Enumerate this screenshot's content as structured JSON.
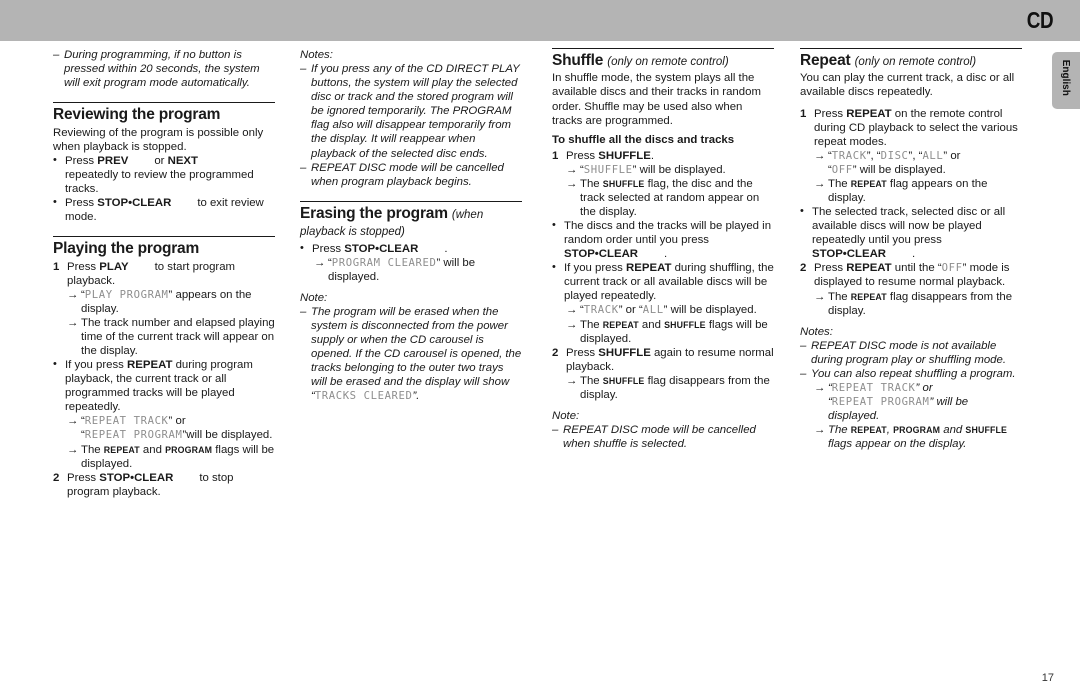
{
  "header": {
    "title": "CD",
    "language_tab": "English"
  },
  "page_number": "17",
  "col1": {
    "note_top": "During programming,  if no button is pressed within 20 seconds, the system will exit program mode automatically.",
    "s1": {
      "heading": "Reviewing the program",
      "intro": "Reviewing of the program is possible only when playback is stopped.",
      "b1_a": "Press ",
      "b1_prev": "PREV",
      "b1_or": "or ",
      "b1_next": "NEXT",
      "b1_b": "repeatedly to review the programmed tracks.",
      "b2_a": "Press ",
      "b2_btn": "STOP•CLEAR",
      "b2_b": "to exit review mode."
    },
    "s2": {
      "heading": "Playing the program",
      "n1_a": "Press ",
      "n1_btn": "PLAY",
      "n1_b": "to start program playback.",
      "a1_q1": "“",
      "a1_lcd": "PLAY PROGRAM",
      "a1_q2": "” appears on the display.",
      "a2": "The track number and elapsed playing time of the current track will appear on the display.",
      "b1_a": "If you press ",
      "b1_btn": "REPEAT",
      "b1_b": " during program playback, the current track or all programmed tracks will be played repeatedly.",
      "a3_lcd1": "REPEAT TRACK",
      "a3_mid": "” or",
      "a3_lcd2": "REPEAT PROGRAM",
      "a3_end": "”will be displayed.",
      "a4_pre": "The ",
      "a4_flag1": "REPEAT",
      "a4_mid": " and ",
      "a4_flag2": "PROGRAM",
      "a4_post": " flags will be displayed.",
      "n2_a": "Press ",
      "n2_btn": "STOP•CLEAR",
      "n2_b": "to stop program playback."
    }
  },
  "col2": {
    "notes_label": "Notes:",
    "note1": "If you press any of the CD DIRECT PLAY buttons, the system will play the selected disc or track and the stored program will be ignored temporarily. The PROGRAM flag also will disappear temporarily from the display. It will reappear when playback of the selected disc ends.",
    "note2": "REPEAT DISC mode will be cancelled when program playback begins.",
    "s1": {
      "heading": "Erasing the program",
      "heading_qual": "(when playback is stopped)",
      "b1_a": "Press ",
      "b1_btn": "STOP•CLEAR",
      "b1_dot": ".",
      "a1_lcd": "PROGRAM CLEARED",
      "a1_post": "” will be displayed.",
      "note_label": "Note:",
      "note_a": "The program will be erased when the system is disconnected from the power supply or when the CD carousel is opened.  If the CD carousel is opened, the tracks belonging to the outer two trays will be erased and the display will show “",
      "note_lcd": "TRACKS CLEARED",
      "note_b": "”."
    }
  },
  "col3": {
    "heading": "Shuffle",
    "heading_qual": "(only on remote control)",
    "intro": "In shuffle mode, the system plays all the available discs and their tracks in random order. Shuffle may be used also when tracks are programmed.",
    "subheading": "To shuffle all the discs and tracks",
    "n1_a": "Press ",
    "n1_btn": "SHUFFLE",
    "n1_dot": ".",
    "a1_lcd": "SHUFFLE",
    "a1_post": "” will be displayed.",
    "a2_pre": "The ",
    "a2_flag": "SHUFFLE",
    "a2_post": " flag, the disc and the track selected at random appear on the display.",
    "b1": "The discs and the tracks will be played in random order until you press",
    "b1_btn": "STOP•CLEAR",
    "b1_dot": ".",
    "b2_a": "If you press ",
    "b2_btn": "REPEAT",
    "b2_b": " during shuffling, the current track or all available discs will be played repeatedly.",
    "a3_lcd1": "TRACK",
    "a3_mid": "” or “",
    "a3_lcd2": "ALL",
    "a3_end": "” will be displayed.",
    "a4_pre": "The ",
    "a4_flag1": "REPEAT",
    "a4_mid": " and ",
    "a4_flag2": "SHUFFLE",
    "a4_post": " flags will be displayed.",
    "n2_a": "Press ",
    "n2_btn": "SHUFFLE",
    "n2_b": " again to resume normal playback.",
    "a5_pre": "The ",
    "a5_flag": "SHUFFLE",
    "a5_post": " flag disappears from the display.",
    "note_label": "Note:",
    "note1": "REPEAT DISC mode will be cancelled when shuffle is selected."
  },
  "col4": {
    "heading": "Repeat",
    "heading_qual": "(only on remote control)",
    "intro": "You can play the current track, a disc or all available discs repeatedly.",
    "n1_a": "Press ",
    "n1_btn": "REPEAT",
    "n1_b": " on the remote control during CD playback to select the various repeat modes.",
    "a1_lcd1": "TRACK",
    "a1_s1": "”, “",
    "a1_lcd2": "DISC",
    "a1_s2": "”, “",
    "a1_lcd3": "ALL",
    "a1_s3": "” or",
    "a1_lcd4": "OFF",
    "a1_end": "” will be displayed.",
    "a2_pre": "The ",
    "a2_flag": "REPEAT",
    "a2_post": " flag appears on the display.",
    "b1": "The selected track, selected disc or all available discs will now be played repeatedly until you press",
    "b1_btn": "STOP•CLEAR",
    "b1_dot": ".",
    "n2_a": "Press ",
    "n2_btn": "REPEAT",
    "n2_b": " until the “",
    "n2_lcd": "OFF",
    "n2_c": "” mode is displayed to resume normal playback.",
    "a3_pre": "The ",
    "a3_flag": "REPEAT",
    "a3_post": " flag disappears from the display.",
    "notes_label": "Notes:",
    "note1": "REPEAT DISC mode is not available during program play or shuffling mode.",
    "note2": "You can also repeat shuffling a program.",
    "a4_lcd1": "REPEAT TRACK",
    "a4_mid": "”  or",
    "a4_lcd2": "REPEAT PROGRAM",
    "a4_end": "” will be displayed.",
    "a5_pre": "The ",
    "a5_flag1": "REPEAT",
    "a5_c": ", ",
    "a5_flag2": "PROGRAM",
    "a5_mid": " and ",
    "a5_flag3": "SHUFFLE",
    "a5_post": " flags appear on the display."
  },
  "glyphs": {
    "dash": "–",
    "bullet": "•",
    "arrow": "→",
    "quote_open": "“",
    "quote_close": "”"
  },
  "colors": {
    "header_gray": "#b4b4b4",
    "text": "#1a1a1a",
    "lcd_gray": "#8e8e8e"
  }
}
